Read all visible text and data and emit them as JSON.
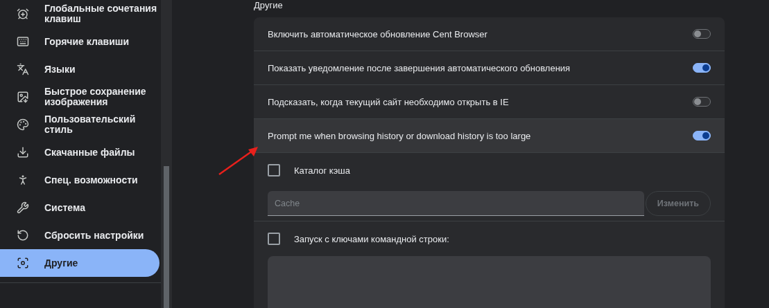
{
  "sidebar": {
    "items": [
      {
        "label": "Глобальные сочетания клавиш",
        "selected": false
      },
      {
        "label": "Горячие клавиши",
        "selected": false
      },
      {
        "label": "Языки",
        "selected": false
      },
      {
        "label": "Быстрое сохранение изображения",
        "selected": false
      },
      {
        "label": "Пользовательский стиль",
        "selected": false
      },
      {
        "label": "Скачанные файлы",
        "selected": false
      },
      {
        "label": "Спец. возможности",
        "selected": false
      },
      {
        "label": "Система",
        "selected": false
      },
      {
        "label": "Сбросить настройки",
        "selected": false
      },
      {
        "label": "Другие",
        "selected": true
      }
    ]
  },
  "section": {
    "title": "Другие",
    "rows": [
      {
        "kind": "toggle",
        "label": "Включить автоматическое обновление Cent Browser",
        "on": false,
        "hovered": false
      },
      {
        "kind": "toggle",
        "label": "Показать уведомление после завершения автоматического обновления",
        "on": true,
        "hovered": false
      },
      {
        "kind": "toggle",
        "label": "Подсказать, когда текущий сайт необходимо открыть в IE",
        "on": false,
        "hovered": false
      },
      {
        "kind": "toggle",
        "label": "Prompt me when browsing history or download history is too large",
        "on": true,
        "hovered": true
      },
      {
        "kind": "checkbox",
        "label": "Каталог кэша",
        "checked": false
      },
      {
        "kind": "path",
        "placeholder": "Cache",
        "button": "Изменить"
      },
      {
        "kind": "checkbox",
        "label": "Запуск с ключами командной строки:",
        "checked": false
      },
      {
        "kind": "textarea"
      }
    ]
  }
}
